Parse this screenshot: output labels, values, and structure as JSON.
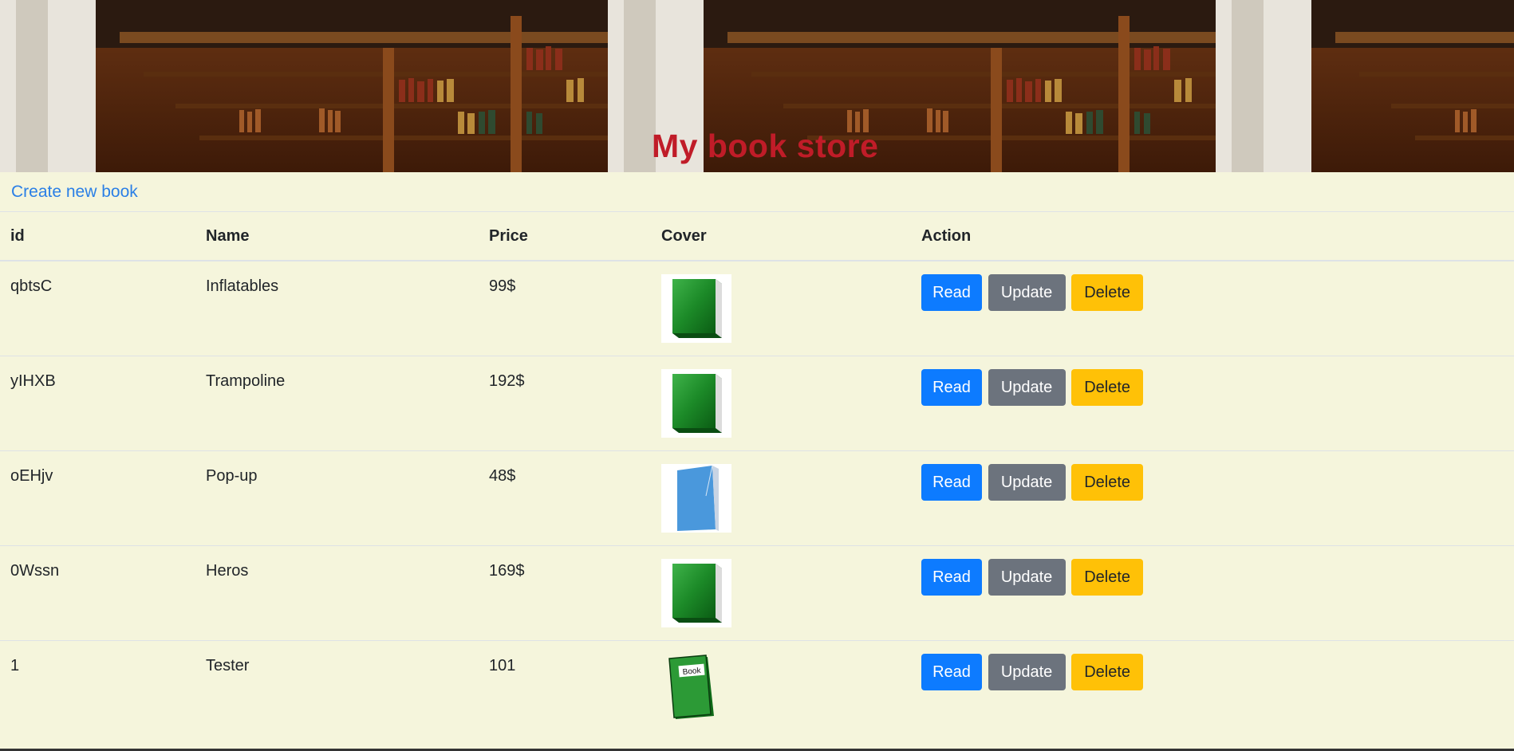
{
  "banner": {
    "title": "My book store",
    "background": "library-bookshelf-photo"
  },
  "create_link": {
    "label": "Create new book"
  },
  "table": {
    "headers": {
      "id": "id",
      "name": "Name",
      "price": "Price",
      "cover": "Cover",
      "action": "Action"
    },
    "rows": [
      {
        "id": "qbtsC",
        "name": "Inflatables",
        "price": "99$",
        "cover": "green-book-icon",
        "read": "Read",
        "update": "Update",
        "delete": "Delete"
      },
      {
        "id": "yIHXB",
        "name": "Trampoline",
        "price": "192$",
        "cover": "green-book-icon",
        "read": "Read",
        "update": "Update",
        "delete": "Delete"
      },
      {
        "id": "oEHjv",
        "name": "Pop-up",
        "price": "48$",
        "cover": "blue-book-icon",
        "read": "Read",
        "update": "Update",
        "delete": "Delete"
      },
      {
        "id": "0Wssn",
        "name": "Heros",
        "price": "169$",
        "cover": "green-book-icon",
        "read": "Read",
        "update": "Update",
        "delete": "Delete"
      },
      {
        "id": "1",
        "name": "Tester",
        "price": "101",
        "cover": "labeled-book-icon",
        "cover_label": "Book",
        "read": "Read",
        "update": "Update",
        "delete": "Delete"
      }
    ]
  },
  "colors": {
    "title": "#c01c28",
    "link": "#2a7fe6",
    "read": "#0d7bff",
    "update": "#6c737d",
    "delete": "#ffc107",
    "background": "#f5f5dc"
  }
}
